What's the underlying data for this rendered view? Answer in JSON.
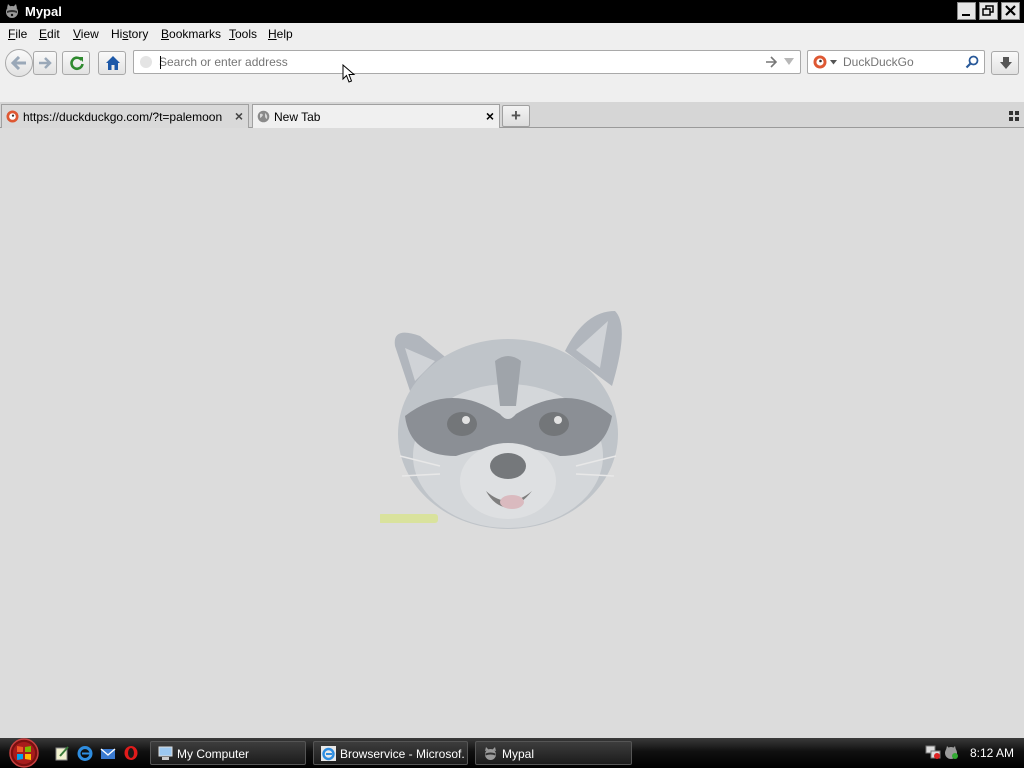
{
  "window": {
    "title": "Mypal"
  },
  "menu": {
    "items": [
      {
        "pre": "",
        "key": "F",
        "post": "ile"
      },
      {
        "pre": "",
        "key": "E",
        "post": "dit"
      },
      {
        "pre": "",
        "key": "V",
        "post": "iew"
      },
      {
        "pre": "Hi",
        "key": "s",
        "post": "tory"
      },
      {
        "pre": "",
        "key": "B",
        "post": "ookmarks"
      },
      {
        "pre": "",
        "key": "T",
        "post": "ools"
      },
      {
        "pre": "",
        "key": "H",
        "post": "elp"
      }
    ]
  },
  "nav": {
    "address_placeholder": "Search or enter address",
    "address_value": "",
    "search_placeholder": "DuckDuckGo",
    "search_value": ""
  },
  "tabs": [
    {
      "label": "https://duckduckgo.com/?t=palemoon",
      "selected": false
    },
    {
      "label": "New Tab",
      "selected": true
    }
  ],
  "taskbar": {
    "tasks": [
      {
        "label": "My Computer"
      },
      {
        "label": "Browservice - Microsof..."
      },
      {
        "label": "Mypal"
      }
    ],
    "clock": "8:12 AM"
  },
  "colors": {
    "titlebar": "#000000",
    "content_bg": "#dcdcdc",
    "accent_blue": "#1c58a8",
    "reload_green": "#2f8a2f",
    "ddg_orange": "#de5833"
  }
}
